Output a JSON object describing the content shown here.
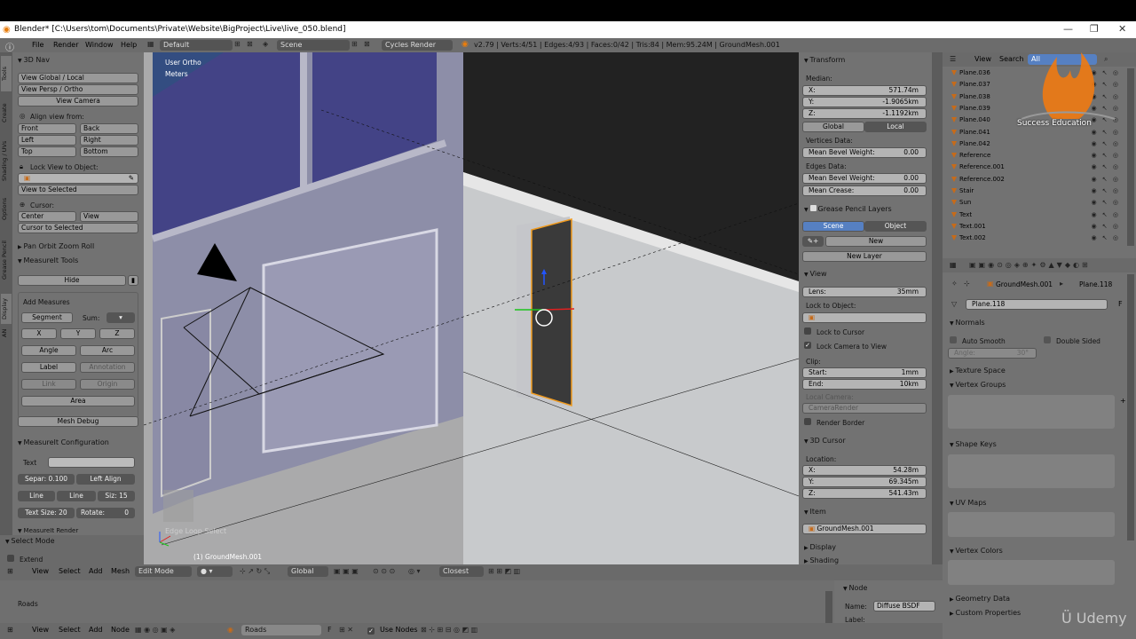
{
  "window": {
    "title": "Blender* [C:\\Users\\tom\\Documents\\Private\\Website\\BigProject\\Live\\live_050.blend]",
    "min": "—",
    "max": "❐",
    "close": "✕"
  },
  "info": {
    "menus": [
      "File",
      "Render",
      "Window",
      "Help"
    ],
    "layout": "Default",
    "scene": "Scene",
    "engine": "Cycles Render",
    "stats": "v2.79 | Verts:4/51 | Edges:4/93 | Faces:0/42 | Tris:84 | Mem:95.24M | GroundMesh.001"
  },
  "toolshelf": {
    "tabs": [
      "Tools",
      "Create",
      "Shading / UVs",
      "Options",
      "Grease Pencil",
      "Display",
      "AN"
    ],
    "nav_title": "3D Nav",
    "view_global": "View Global / Local",
    "view_persp": "View Persp / Ortho",
    "view_camera": "View Camera",
    "align_from": "Align view from:",
    "front": "Front",
    "back": "Back",
    "left": "Left",
    "right": "Right",
    "top": "Top",
    "bottom": "Bottom",
    "lock_view": "Lock View to Object:",
    "view_selected": "View to Selected",
    "cursor": "Cursor:",
    "center": "Center",
    "view": "View",
    "cursor_selected": "Cursor to Selected",
    "pan_orbit": "Pan Orbit Zoom Roll",
    "mt_title": "MeasureIt Tools",
    "hide": "Hide",
    "add_measures": "Add Measures",
    "segment": "Segment",
    "sum": "Sum:",
    "x": "X",
    "y": "Y",
    "z": "Z",
    "angle": "Angle",
    "arc": "Arc",
    "label": "Label",
    "annotation": "Annotation",
    "link": "Link",
    "origin": "Origin",
    "area": "Area",
    "mesh_debug": "Mesh Debug",
    "config_title": "MeasureIt Configuration",
    "text": "Text",
    "separ": "Separ: 0.100",
    "left_align": "Left Align",
    "line1": "Line",
    "line2": "Line",
    "siz": "Siz: 15",
    "text_size": "Text Size: 20",
    "rotate": "Rotate:",
    "rotate_val": "0",
    "render_title": "MeasureIt Render",
    "select_mode": "Select Mode",
    "extend": "Extend"
  },
  "viewport": {
    "user_ortho": "User Ortho",
    "units": "Meters",
    "object_label": "(1) GroundMesh.001",
    "loop_select": "Edge Loop Select"
  },
  "nprops": {
    "transform": "Transform",
    "median": "Median:",
    "x_label": "X:",
    "x_val": "571.74m",
    "y_label": "Y:",
    "y_val": "-1.9065km",
    "z_label": "Z:",
    "z_val": "-1.1192km",
    "global": "Global",
    "local": "Local",
    "vdata": "Vertices Data:",
    "mbw1": "Mean Bevel Weight:",
    "mbw1_v": "0.00",
    "edata": "Edges Data:",
    "mbw2": "Mean Bevel Weight:",
    "mbw2_v": "0.00",
    "mcrease": "Mean Crease:",
    "mcrease_v": "0.00",
    "gpl": "Grease Pencil Layers",
    "scene": "Scene",
    "object": "Object",
    "new": "New",
    "new_layer": "New Layer",
    "view": "View",
    "lens": "Lens:",
    "lens_v": "35mm",
    "lock_obj": "Lock to Object:",
    "lock_cursor": "Lock to Cursor",
    "lock_cam": "Lock Camera to View",
    "clip": "Clip:",
    "start": "Start:",
    "start_v": "1mm",
    "end": "End:",
    "end_v": "10km",
    "local_camera": "Local Camera:",
    "camera_render": "CameraRender",
    "render_border": "Render Border",
    "cursor3d": "3D Cursor",
    "location": "Location:",
    "cx": "X:",
    "cx_v": "54.28m",
    "cy": "Y:",
    "cy_v": "69.345m",
    "cz": "Z:",
    "cz_v": "541.43m",
    "item": "Item",
    "item_name": "GroundMesh.001",
    "display": "Display",
    "shading": "Shading"
  },
  "vp_header": {
    "view": "View",
    "select": "Select",
    "add": "Add",
    "mesh": "Mesh",
    "mode": "Edit Mode",
    "orient": "Global",
    "snap": "Closest"
  },
  "node_editor": {
    "roads": "Roads",
    "node_title": "Node",
    "name_label": "Name:",
    "name_val": "Diffuse BSDF",
    "label_label": "Label:",
    "view": "View",
    "select": "Select",
    "add": "Add",
    "node": "Node",
    "tree": "Roads",
    "f": "F",
    "use_nodes": "Use Nodes"
  },
  "outliner": {
    "view": "View",
    "search": "Search",
    "all": "All",
    "items": [
      "Plane.036",
      "Plane.037",
      "Plane.038",
      "Plane.039",
      "Plane.040",
      "Plane.041",
      "Plane.042",
      "Reference",
      "Reference.001",
      "Reference.002",
      "Stair",
      "Sun",
      "Text",
      "Text.001",
      "Text.002"
    ]
  },
  "props": {
    "crumb1": "GroundMesh.001",
    "crumb2": "Plane.118",
    "mesh_name": "Plane.118",
    "f": "F",
    "normals": "Normals",
    "auto_smooth": "Auto Smooth",
    "double_sided": "Double Sided",
    "angle": "Angle:",
    "angle_v": "30°",
    "texture_space": "Texture Space",
    "vertex_groups": "Vertex Groups",
    "shape_keys": "Shape Keys",
    "uv_maps": "UV Maps",
    "vertex_colors": "Vertex Colors",
    "geometry_data": "Geometry Data",
    "custom_props": "Custom Properties"
  },
  "watermark": {
    "brand": "Success Education",
    "udemy": "Udemy"
  },
  "colors": {
    "accent": "#5680c2",
    "panel": "#727272",
    "viewport": "#a9a9a9",
    "selection": "#f09a1d"
  }
}
